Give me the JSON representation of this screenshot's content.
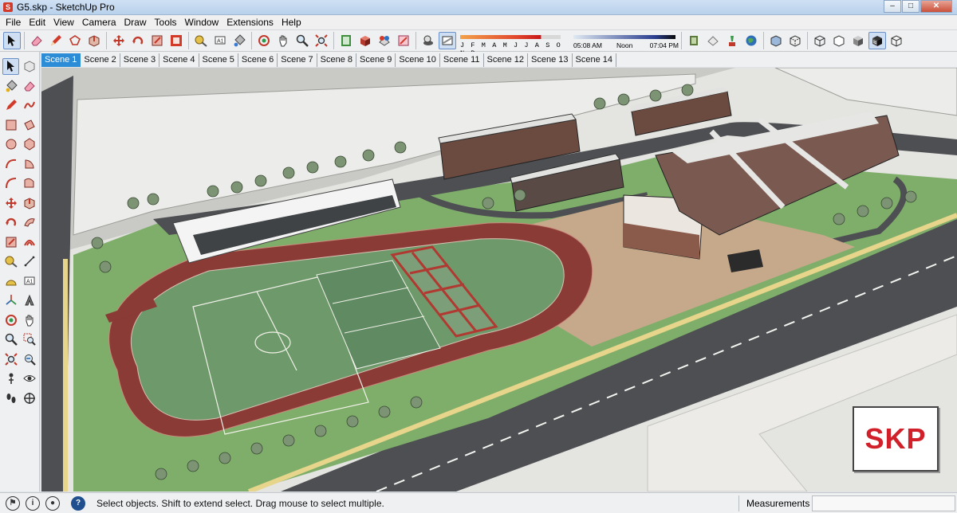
{
  "window": {
    "title": "G5.skp - SketchUp Pro",
    "icon": "sketchup-app-icon",
    "min": "–",
    "max": "□",
    "close": "✕"
  },
  "menu": [
    "File",
    "Edit",
    "View",
    "Camera",
    "Draw",
    "Tools",
    "Window",
    "Extensions",
    "Help"
  ],
  "toolbar": {
    "tools": [
      "select-icon",
      "eraser-icon",
      "pencil-line-icon",
      "shapes-icon",
      "push-pull-icon",
      "move-icon",
      "rotate-icon",
      "scale-icon",
      "offset-icon",
      "tape-measure-icon",
      "text-icon",
      "paint-bucket-icon",
      "orbit-icon",
      "pan-icon",
      "zoom-icon",
      "zoom-extents-icon",
      "model-info-icon",
      "components-icon",
      "materials-icon",
      "styles-icon",
      "shadows-icon",
      "fog-icon"
    ],
    "months_label": "J F M A M J J A S O N D",
    "time_start": "05:08 AM",
    "time_noon": "Noon",
    "time_end": "07:04 PM",
    "view_tools": [
      "3d-warehouse-icon",
      "extension-warehouse-icon",
      "layout-icon",
      "geo-location-icon",
      "xray-icon",
      "back-edges-icon",
      "wireframe-icon",
      "hidden-line-icon",
      "shaded-icon",
      "shaded-textures-icon",
      "monochrome-icon"
    ]
  },
  "scenes": [
    "Scene 1",
    "Scene 2",
    "Scene 3",
    "Scene 4",
    "Scene 5",
    "Scene 6",
    "Scene 7",
    "Scene 8",
    "Scene 9",
    "Scene 10",
    "Scene 11",
    "Scene 12",
    "Scene 13",
    "Scene 14"
  ],
  "active_scene": "Scene 1",
  "left_tools": [
    "select-icon",
    "component-icon",
    "paint-bucket-icon",
    "eraser-icon",
    "line-icon",
    "freehand-icon",
    "rectangle-icon",
    "rotated-rectangle-icon",
    "circle-icon",
    "polygon-icon",
    "arc-icon",
    "pie-icon",
    "two-point-arc-icon",
    "three-point-arc-icon",
    "move-icon",
    "push-pull-icon",
    "rotate-icon",
    "follow-me-icon",
    "scale-icon",
    "offset-icon",
    "tape-measure-icon",
    "dimension-icon",
    "protractor-icon",
    "text-icon",
    "axes-icon",
    "3d-text-icon",
    "orbit-icon",
    "pan-icon",
    "zoom-icon",
    "zoom-window-icon",
    "zoom-extents-icon",
    "previous-view-icon",
    "position-camera-icon",
    "look-around-icon",
    "walk-icon",
    "section-plane-icon"
  ],
  "logo": {
    "text": "SKP"
  },
  "status": {
    "icons": [
      "geo-location-icon",
      "credits-icon",
      "user-icon",
      "help-icon"
    ],
    "text": "Select objects. Shift to extend select. Drag mouse to select multiple.",
    "measurements_label": "Measurements",
    "measurements_value": ""
  },
  "colors": {
    "track": "#8a3b36",
    "field": "#6e9a6b",
    "grass": "#7fae6a",
    "road": "#4d4f52",
    "plaza": "#c6a98b",
    "ground": "#e8e8e6",
    "accent": "#2c8cd6",
    "logo_red": "#d2202a"
  }
}
